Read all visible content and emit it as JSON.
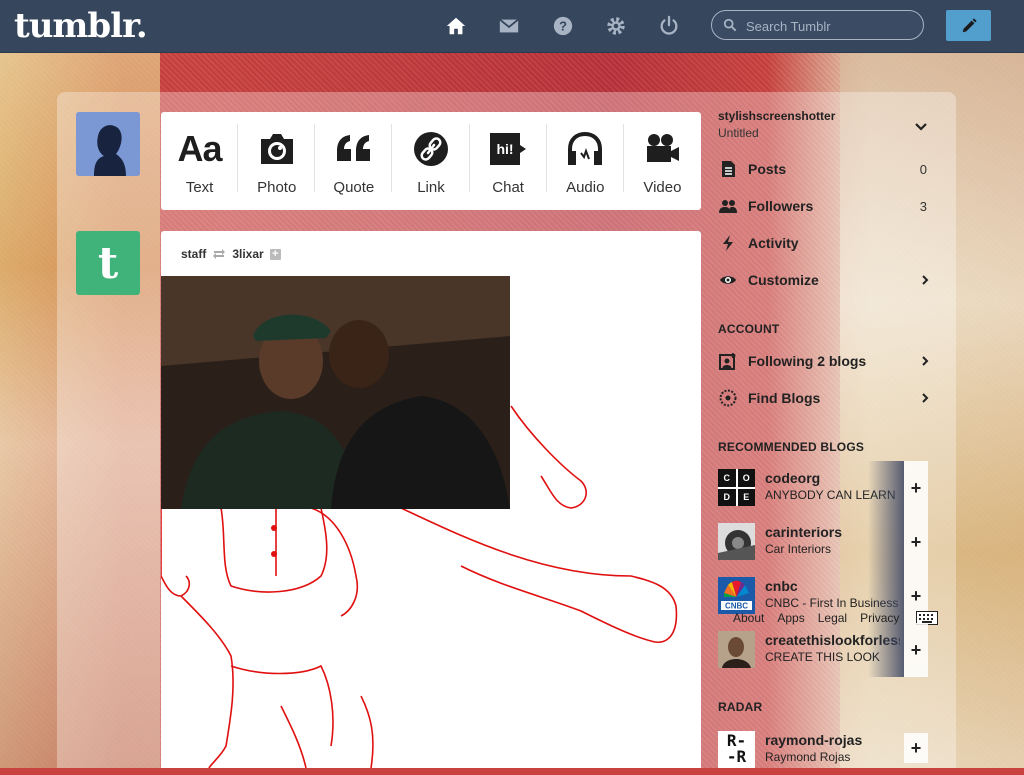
{
  "app": {
    "logo": "tumblr."
  },
  "header": {
    "search_placeholder": "Search Tumblr",
    "nav": [
      "home-icon",
      "mail-icon",
      "help-icon",
      "settings-icon",
      "power-icon"
    ],
    "compose_icon": "pencil-icon",
    "colors": {
      "bar": "#36465d",
      "compose": "#529ecc"
    }
  },
  "post_types": [
    {
      "label": "Text",
      "icon": "text-icon",
      "glyph": "Aa"
    },
    {
      "label": "Photo",
      "icon": "camera-icon"
    },
    {
      "label": "Quote",
      "icon": "quote-icon"
    },
    {
      "label": "Link",
      "icon": "link-icon"
    },
    {
      "label": "Chat",
      "icon": "chat-icon",
      "glyph": "hi!"
    },
    {
      "label": "Audio",
      "icon": "headphones-icon"
    },
    {
      "label": "Video",
      "icon": "video-camera-icon"
    }
  ],
  "post": {
    "author": "staff",
    "reblogged_from": "3lixar"
  },
  "sidebar": {
    "blog_name": "stylishscreenshotter",
    "blog_title": "Untitled",
    "stats": [
      {
        "label": "Posts",
        "count": "0"
      },
      {
        "label": "Followers",
        "count": "3"
      },
      {
        "label": "Activity"
      },
      {
        "label": "Customize"
      }
    ],
    "account_heading": "ACCOUNT",
    "account_items": [
      {
        "label": "Following 2 blogs"
      },
      {
        "label": "Find Blogs"
      }
    ],
    "recommended_heading": "RECOMMENDED BLOGS",
    "recommended": [
      {
        "name": "codeorg",
        "subtitle": "ANYBODY CAN LEARN",
        "avatar_letters": [
          "C",
          "O",
          "D",
          "E"
        ]
      },
      {
        "name": "carinteriors",
        "subtitle": "Car Interiors"
      },
      {
        "name": "cnbc",
        "subtitle": "CNBC - First In Business"
      },
      {
        "name": "createthislookforless",
        "subtitle": "CREATE THIS LOOK"
      }
    ],
    "footer_links": [
      "About",
      "Apps",
      "Legal",
      "Privacy"
    ],
    "radar_heading": "RADAR",
    "radar": {
      "name": "raymond-rojas",
      "subtitle": "Raymond Rojas",
      "avatar_text": "R-\n-R"
    }
  }
}
